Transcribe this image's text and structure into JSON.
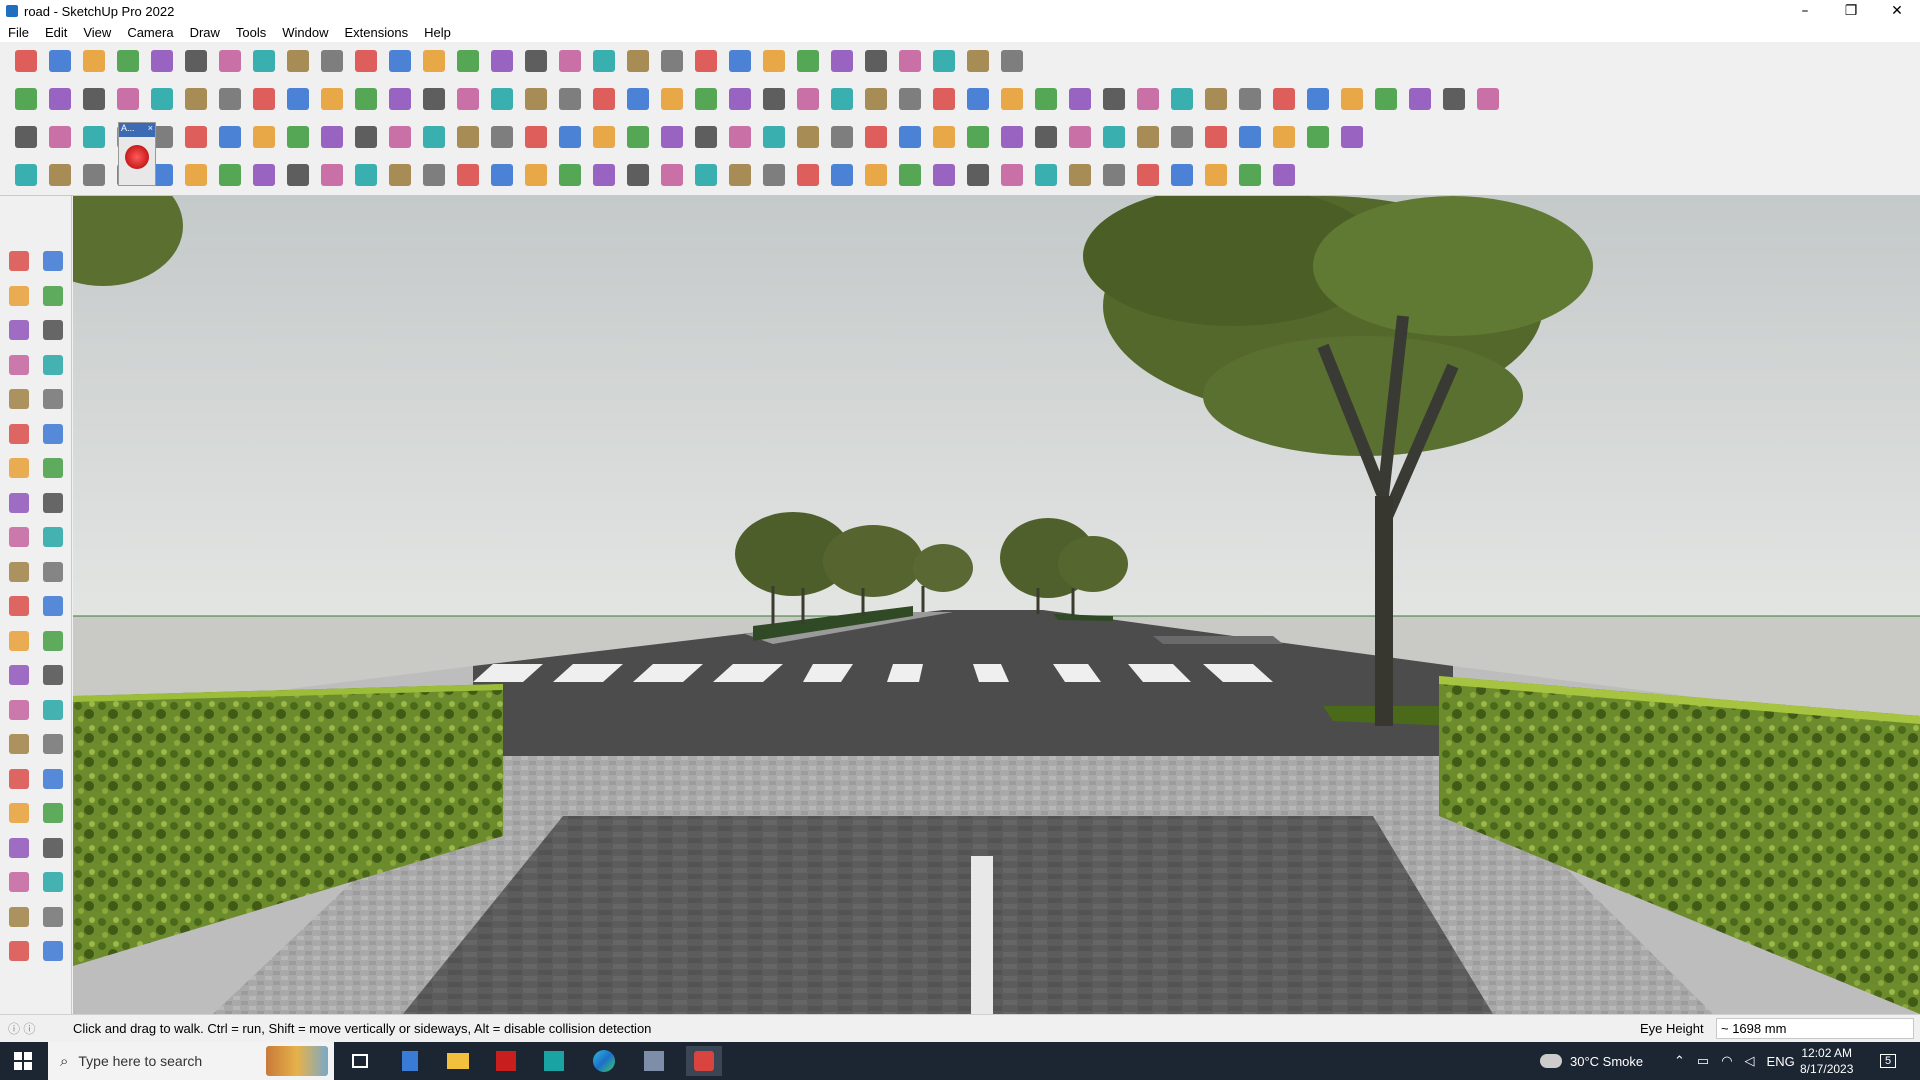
{
  "window": {
    "title": "road - SketchUp Pro 2022",
    "controls": [
      "minimize-icon",
      "restore-icon",
      "close-icon"
    ]
  },
  "menu": [
    "File",
    "Edit",
    "View",
    "Camera",
    "Draw",
    "Tools",
    "Window",
    "Extensions",
    "Help"
  ],
  "toolbars": {
    "row1_count": 30,
    "row2_count": 44,
    "row3_count": 40,
    "row4_count": 38,
    "mini_toolbar": {
      "label": "A...",
      "close": "×"
    }
  },
  "left_toolbar_icons": [
    "select-icon",
    "orbit-icon",
    "paint-bucket-icon",
    "eraser-icon",
    "component-icon",
    "pencil-tag-icon",
    "line-icon",
    "freehand-icon",
    "rectangle-icon",
    "rotated-rectangle-icon",
    "circle-icon",
    "polygon-icon",
    "arc-icon",
    "two-point-arc-icon",
    "pie-icon",
    "three-point-arc-icon",
    "move-icon",
    "push-pull-icon",
    "rotate-icon",
    "follow-me-icon",
    "scale-icon",
    "offset-icon",
    "tape-measure-icon",
    "dimension-icon",
    "protractor-icon",
    "text-icon",
    "axes-icon",
    "3d-text-icon",
    "orbit-view-icon",
    "pan-icon",
    "zoom-icon",
    "zoom-window-icon",
    "zoom-extents-icon",
    "previous-view-icon",
    "position-camera-icon",
    "look-around-icon",
    "walk-icon",
    "section-plane-icon",
    "sandbox-icon",
    "sandbox-scratch-icon",
    "smoove-icon",
    "stamp-icon"
  ],
  "status": {
    "message": "Click and drag to walk.  Ctrl = run, Shift = move vertically or sideways, Alt = disable collision detection",
    "eye_height_label": "Eye Height",
    "eye_height_value": "~ 1698 mm"
  },
  "taskbar": {
    "search_placeholder": "Type here to search",
    "weather": "30°C  Smoke",
    "language": "ENG",
    "time": "12:02 AM",
    "date": "8/17/2023",
    "notification_count": "5"
  },
  "colors": {
    "sky": "#cfd3d3",
    "asphalt": "#4a4a4a",
    "hedge": "#6d8f2a",
    "taskbar": "#1c2532"
  }
}
